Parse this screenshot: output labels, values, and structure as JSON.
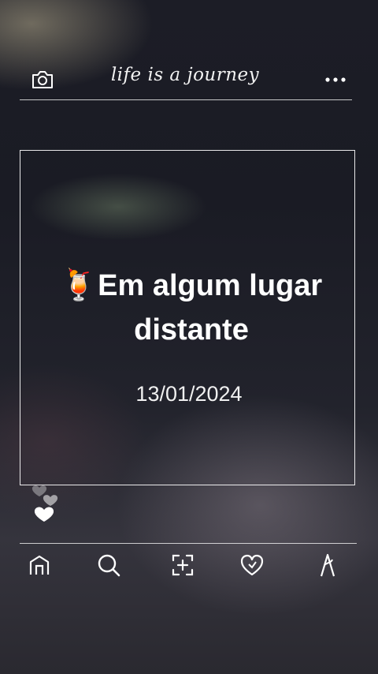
{
  "header": {
    "title": "life is a journey",
    "camera_icon": "camera-icon",
    "more_icon": "more-dots-icon"
  },
  "post": {
    "emoji": "🍹",
    "headline": "Em algum lugar distante",
    "date": "13/01/2024"
  },
  "nav": {
    "items": [
      {
        "icon": "home-icon"
      },
      {
        "icon": "search-icon"
      },
      {
        "icon": "add-post-icon"
      },
      {
        "icon": "heart-icon"
      },
      {
        "icon": "profile-icon"
      }
    ]
  },
  "colors": {
    "foreground": "#ffffff",
    "background": "#1c1d26"
  }
}
